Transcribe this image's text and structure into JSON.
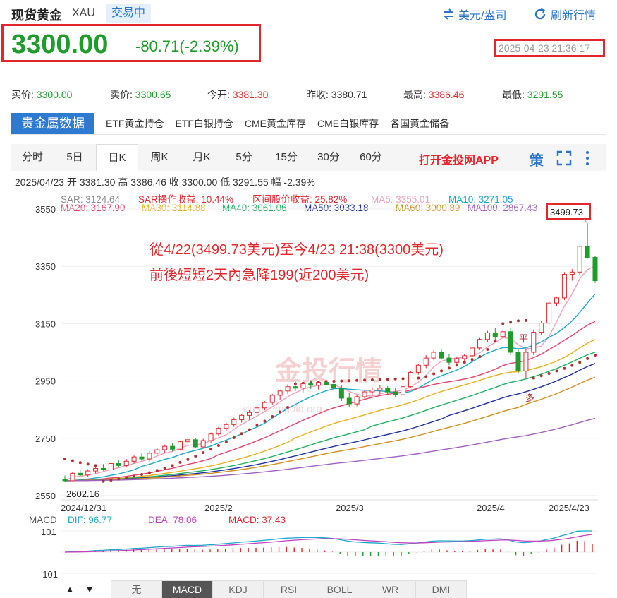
{
  "header": {
    "title": "现货黄金",
    "symbol": "XAU",
    "status": "交易中",
    "currency_btn": "美元/盎司",
    "refresh_btn": "刷新行情",
    "price": "3300.00",
    "change": "-80.71(-2.39%)",
    "timestamp": "2025-04-23 21:36:17"
  },
  "quote": {
    "bid_label": "买价:",
    "bid": "3300.00",
    "ask_label": "卖价:",
    "ask": "3300.65",
    "open_label": "今开:",
    "open": "3381.30",
    "prev_label": "昨收:",
    "prev": "3380.71",
    "high_label": "最高:",
    "high": "3386.46",
    "low_label": "最低:",
    "low": "3291.55"
  },
  "tabs": [
    "贵金属数据",
    "ETF黄金持仓",
    "ETF白银持仓",
    "CME黄金库存",
    "CME白银库存",
    "各国黄金储备"
  ],
  "periods": [
    "分时",
    "5日",
    "日K",
    "周K",
    "月K",
    "5分",
    "15分",
    "30分",
    "60分"
  ],
  "open_app": "打开金投网APP",
  "ce_icon_text": "策",
  "bar_info": {
    "date": "2025/04/23",
    "open_label": "开",
    "open": "3381.30",
    "high_label": "高",
    "high": "3386.46",
    "close_label": "收",
    "close": "3300.00",
    "low_label": "低",
    "low": "3291.55",
    "amp_label": "幅",
    "amp": "-2.39%"
  },
  "indicators1": [
    {
      "text": "SAR: 3124.64",
      "color": "#888888"
    },
    {
      "text": "SAR操作收益: 10.44%",
      "color": "#e3262c"
    },
    {
      "text": "区间股价收益: 25.82%",
      "color": "#e3262c"
    },
    {
      "text": "MA5: 3355.01",
      "color": "#f0a0b8"
    },
    {
      "text": "MA10: 3271.05",
      "color": "#1aa8c8"
    }
  ],
  "indicators2": [
    {
      "text": "MA20: 3167.90",
      "color": "#e0446a"
    },
    {
      "text": "MA30: 3114.88",
      "color": "#e8b020"
    },
    {
      "text": "MA40: 3061.06",
      "color": "#20b060"
    },
    {
      "text": "MA50: 3033.18",
      "color": "#2030a0"
    },
    {
      "text": "MA60: 3000.89",
      "color": "#d09020"
    },
    {
      "text": "MA100: 2867.43",
      "color": "#a060c0"
    }
  ],
  "annotation": {
    "line1": "從4/22(3499.73美元)至今4/23 21:38(3300美元)",
    "line2": "前後短短2天內急降199(近200美元)"
  },
  "macd_legend": {
    "label": "MACD",
    "dif": "DIF: 96.77",
    "dea": "DEA: 78.06",
    "macd": "MACD: 37.43",
    "dif_color": "#1aa8c8",
    "dea_color": "#c040c0",
    "macd_color": "#e3262c"
  },
  "macd_ticks": [
    "101",
    "-101"
  ],
  "bottom_tabs": [
    "无",
    "MACD",
    "KDJ",
    "RSI",
    "BOLL",
    "WR",
    "DMI"
  ],
  "watermark": "金投行情",
  "watermark_sub": "quote.cngold.org",
  "chart_data": {
    "type": "candlestick",
    "x_labels": [
      "2024/12/31",
      "2025/2",
      "2025/3",
      "2025/4",
      "2025/4/23"
    ],
    "y_ticks": [
      3550,
      3350,
      3150,
      2950,
      2750,
      2550
    ],
    "ylim": [
      2550,
      3550
    ],
    "max_label": "3499.73",
    "min_label": "2602.16",
    "sar_labels": [
      "平",
      "多"
    ],
    "colors": {
      "up": "#e3262c",
      "down": "#1f9d2a",
      "sar": "#b03030",
      "grid": "#eeeeee"
    },
    "candles": [
      [
        2608,
        2620,
        2598,
        2602
      ],
      [
        2602,
        2632,
        2600,
        2628
      ],
      [
        2628,
        2640,
        2618,
        2622
      ],
      [
        2622,
        2642,
        2615,
        2636
      ],
      [
        2636,
        2650,
        2628,
        2645
      ],
      [
        2645,
        2660,
        2637,
        2640
      ],
      [
        2640,
        2668,
        2634,
        2662
      ],
      [
        2662,
        2675,
        2650,
        2655
      ],
      [
        2655,
        2678,
        2648,
        2670
      ],
      [
        2670,
        2690,
        2662,
        2685
      ],
      [
        2685,
        2700,
        2672,
        2678
      ],
      [
        2678,
        2705,
        2670,
        2698
      ],
      [
        2698,
        2715,
        2690,
        2710
      ],
      [
        2710,
        2728,
        2700,
        2722
      ],
      [
        2722,
        2732,
        2705,
        2712
      ],
      [
        2712,
        2742,
        2708,
        2738
      ],
      [
        2738,
        2750,
        2728,
        2745
      ],
      [
        2745,
        2752,
        2715,
        2720
      ],
      [
        2720,
        2748,
        2715,
        2742
      ],
      [
        2742,
        2770,
        2735,
        2765
      ],
      [
        2765,
        2790,
        2758,
        2785
      ],
      [
        2785,
        2805,
        2775,
        2798
      ],
      [
        2798,
        2822,
        2790,
        2815
      ],
      [
        2815,
        2835,
        2805,
        2830
      ],
      [
        2830,
        2848,
        2815,
        2840
      ],
      [
        2840,
        2862,
        2830,
        2856
      ],
      [
        2856,
        2880,
        2848,
        2875
      ],
      [
        2875,
        2905,
        2868,
        2900
      ],
      [
        2900,
        2920,
        2885,
        2915
      ],
      [
        2915,
        2938,
        2905,
        2930
      ],
      [
        2930,
        2948,
        2915,
        2925
      ],
      [
        2925,
        2946,
        2910,
        2940
      ],
      [
        2940,
        2952,
        2922,
        2935
      ],
      [
        2935,
        2950,
        2920,
        2945
      ],
      [
        2945,
        2955,
        2930,
        2938
      ],
      [
        2938,
        2948,
        2915,
        2925
      ],
      [
        2925,
        2935,
        2880,
        2890
      ],
      [
        2890,
        2910,
        2860,
        2870
      ],
      [
        2870,
        2900,
        2862,
        2895
      ],
      [
        2895,
        2920,
        2888,
        2912
      ],
      [
        2912,
        2928,
        2900,
        2918
      ],
      [
        2918,
        2935,
        2905,
        2925
      ],
      [
        2925,
        2932,
        2905,
        2912
      ],
      [
        2912,
        2926,
        2895,
        2902
      ],
      [
        2902,
        2935,
        2898,
        2930
      ],
      [
        2930,
        2985,
        2925,
        2980
      ],
      [
        2980,
        3010,
        2972,
        3005
      ],
      [
        3005,
        3040,
        2995,
        3030
      ],
      [
        3030,
        3058,
        3022,
        3050
      ],
      [
        3050,
        3060,
        3025,
        3030
      ],
      [
        3030,
        3045,
        3005,
        3015
      ],
      [
        3015,
        3035,
        3005,
        3028
      ],
      [
        3028,
        3045,
        3015,
        3038
      ],
      [
        3038,
        3070,
        3032,
        3065
      ],
      [
        3065,
        3100,
        3058,
        3095
      ],
      [
        3095,
        3125,
        3085,
        3118
      ],
      [
        3118,
        3135,
        3095,
        3105
      ],
      [
        3105,
        3128,
        3100,
        3122
      ],
      [
        3122,
        3135,
        3040,
        3050
      ],
      [
        3050,
        3060,
        2975,
        2985
      ],
      [
        2985,
        3060,
        2960,
        3050
      ],
      [
        3050,
        3130,
        3040,
        3120
      ],
      [
        3120,
        3160,
        3110,
        3152
      ],
      [
        3152,
        3230,
        3145,
        3222
      ],
      [
        3222,
        3245,
        3210,
        3240
      ],
      [
        3240,
        3330,
        3232,
        3322
      ],
      [
        3322,
        3340,
        3300,
        3330
      ],
      [
        3330,
        3425,
        3320,
        3420
      ],
      [
        3420,
        3499.73,
        3400,
        3381
      ],
      [
        3381.3,
        3386.46,
        3291.55,
        3300
      ]
    ],
    "sar": [
      2678,
      2672,
      2665,
      2660,
      2655,
      2600,
      2604,
      2608,
      2612,
      2618,
      2624,
      2630,
      2638,
      2646,
      2655,
      2666,
      2676,
      2688,
      2700,
      2712,
      2725,
      2738,
      2752,
      2766,
      2780,
      2795,
      2810,
      2826,
      2842,
      2858,
      2940,
      2942,
      2944,
      2946,
      2948,
      2949,
      2950,
      2951,
      2952,
      2953,
      2954,
      2955,
      2956,
      2957,
      2958,
      2959,
      2960,
      2965,
      2975,
      2985,
      2995,
      3005,
      3015,
      3025,
      3035,
      3060,
      3090,
      3150,
      3155,
      3160,
      3161,
      2960,
      2968,
      2976,
      2985,
      2994,
      3004,
      3015,
      3028,
      3040
    ],
    "ma_series": [
      {
        "name": "MA5",
        "color": "#f0a0b8",
        "ma": 5
      },
      {
        "name": "MA10",
        "color": "#1aa8c8",
        "ma": 10
      },
      {
        "name": "MA20",
        "color": "#e0446a",
        "ma": 20
      },
      {
        "name": "MA30",
        "color": "#e8b020",
        "ma": 30
      },
      {
        "name": "MA40",
        "color": "#20b060",
        "ma": 40
      },
      {
        "name": "MA50",
        "color": "#2030a0",
        "ma": 50
      },
      {
        "name": "MA60",
        "color": "#d09020",
        "ma": 60
      },
      {
        "name": "MA100",
        "color": "#a060c0",
        "ma": 100
      }
    ],
    "macd_ylim": [
      -101,
      101
    ]
  }
}
